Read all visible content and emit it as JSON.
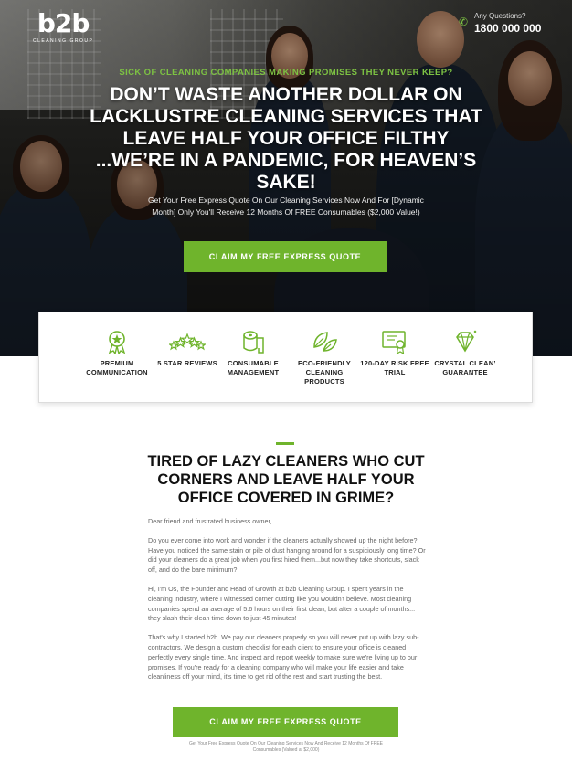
{
  "header": {
    "logo_text": "b2b",
    "logo_sub": "CLEANING GROUP",
    "contact_label": "Any Questions?",
    "phone": "1800 000 000"
  },
  "hero": {
    "eyebrow": "SICK OF CLEANING COMPANIES MAKING PROMISES THEY NEVER KEEP?",
    "headline": "DON’T WASTE ANOTHER DOLLAR ON LACKLUSTRE CLEANING SERVICES THAT LEAVE HALF YOUR OFFICE FILTHY ...WE’RE IN A PANDEMIC, FOR HEAVEN’S SAKE!",
    "subcopy": "Get Your Free Express Quote On Our Cleaning Services Now And For [Dynamic Month] Only You'll Receive 12 Months Of FREE Consumables ($2,000 Value!)",
    "cta": "CLAIM MY FREE EXPRESS QUOTE"
  },
  "features": [
    {
      "icon": "award-badge-icon",
      "label": "PREMIUM COMMUNICATION"
    },
    {
      "icon": "five-stars-icon",
      "label": "5 STAR REVIEWS"
    },
    {
      "icon": "toilet-roll-icon",
      "label": "CONSUMABLE MANAGEMENT"
    },
    {
      "icon": "leaves-icon",
      "label": "ECO-FRIENDLY CLEANING PRODUCTS"
    },
    {
      "icon": "certificate-icon",
      "label": "120-DAY RISK FREE TRIAL"
    },
    {
      "icon": "diamond-icon",
      "label": "CRYSTAL CLEAN’ GUARANTEE"
    }
  ],
  "section": {
    "title": "TIRED OF LAZY CLEANERS WHO CUT CORNERS AND LEAVE HALF YOUR OFFICE COVERED IN GRIME?",
    "paragraphs": [
      "Dear friend and frustrated business owner,",
      "Do you ever come into work and wonder if the cleaners actually showed up the night before? Have you noticed the same stain or pile of dust hanging around for a suspiciously long time? Or did your cleaners do a great job when you first hired them...but now they take shortcuts, slack off, and do the bare minimum?",
      "Hi, I'm Os, the Founder and Head of Growth at b2b Cleaning Group. I spent years in the cleaning industry, where I witnessed corner cutting like you wouldn't believe. Most cleaning companies spend an average of 5.6 hours on their first clean, but after a couple of months... they slash their clean time down to just 45 minutes!",
      "That's why I started b2b. We pay our cleaners properly so you will never put up with lazy sub-contractors. We design a custom checklist for each client to ensure your office is cleaned perfectly every single time. And inspect and report weekly to make sure we're living up to our promises. If you're ready for a cleaning company who will make your life easier and take cleanliness off your mind, it's time to get rid of the rest and start trusting the best."
    ],
    "cta": "CLAIM MY FREE EXPRESS QUOTE",
    "fineprint": "Get Your Free Express Quote On Our Cleaning Services Now And Receive 12 Months Of FREE Consumables (Valued at $2,000)"
  },
  "colors": {
    "accent": "#6fb42c",
    "eyebrow": "#7dc243"
  }
}
